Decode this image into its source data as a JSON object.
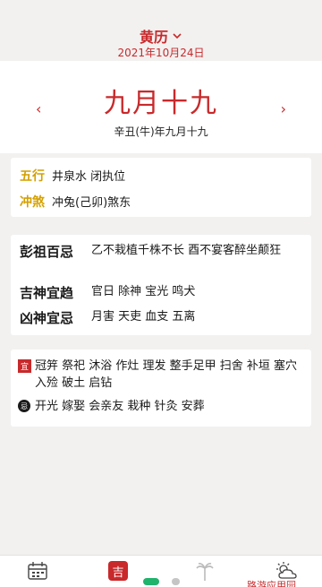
{
  "header": {
    "title": "黄历",
    "date": "2021年10月24日"
  },
  "lunar": {
    "main": "九月十九",
    "sub": "辛丑(牛)年九月十九",
    "prev_label": "‹",
    "next_label": "›"
  },
  "info1": {
    "wuxing_label": "五行",
    "wuxing_value": "井泉水 闭执位",
    "chongsha_label": "冲煞",
    "chongsha_value": "冲兔(己卯)煞东"
  },
  "info2": {
    "pengzu_label": "彭祖百忌",
    "pengzu_value": "乙不栽植千株不长 酉不宴客醉坐颠狂",
    "jishen_label": "吉神宜趋",
    "jishen_value": "官日 除神 宝光 鸣犬",
    "xiongshen_label": "凶神宜忌",
    "xiongshen_value": "月害 天吏 血支 五离"
  },
  "yiji": {
    "yi_badge": "宜",
    "yi_value": "冠笄 祭祀 沐浴 作灶 理发 整手足甲 扫舍 补垣 塞穴 入殓 破土 启钻",
    "ji_badge": "忌",
    "ji_value": "开光 嫁娶 会亲友 栽种 针灸 安葬"
  },
  "bottom_nav": {
    "ji_label": "吉",
    "items": [
      "calendar-icon",
      "ji-icon",
      "palm-icon",
      "weather-icon"
    ]
  },
  "watermark": "路游应用园",
  "colors": {
    "accent": "#c8292b",
    "gold": "#d4a000",
    "dot_active": "#1fb36b"
  }
}
